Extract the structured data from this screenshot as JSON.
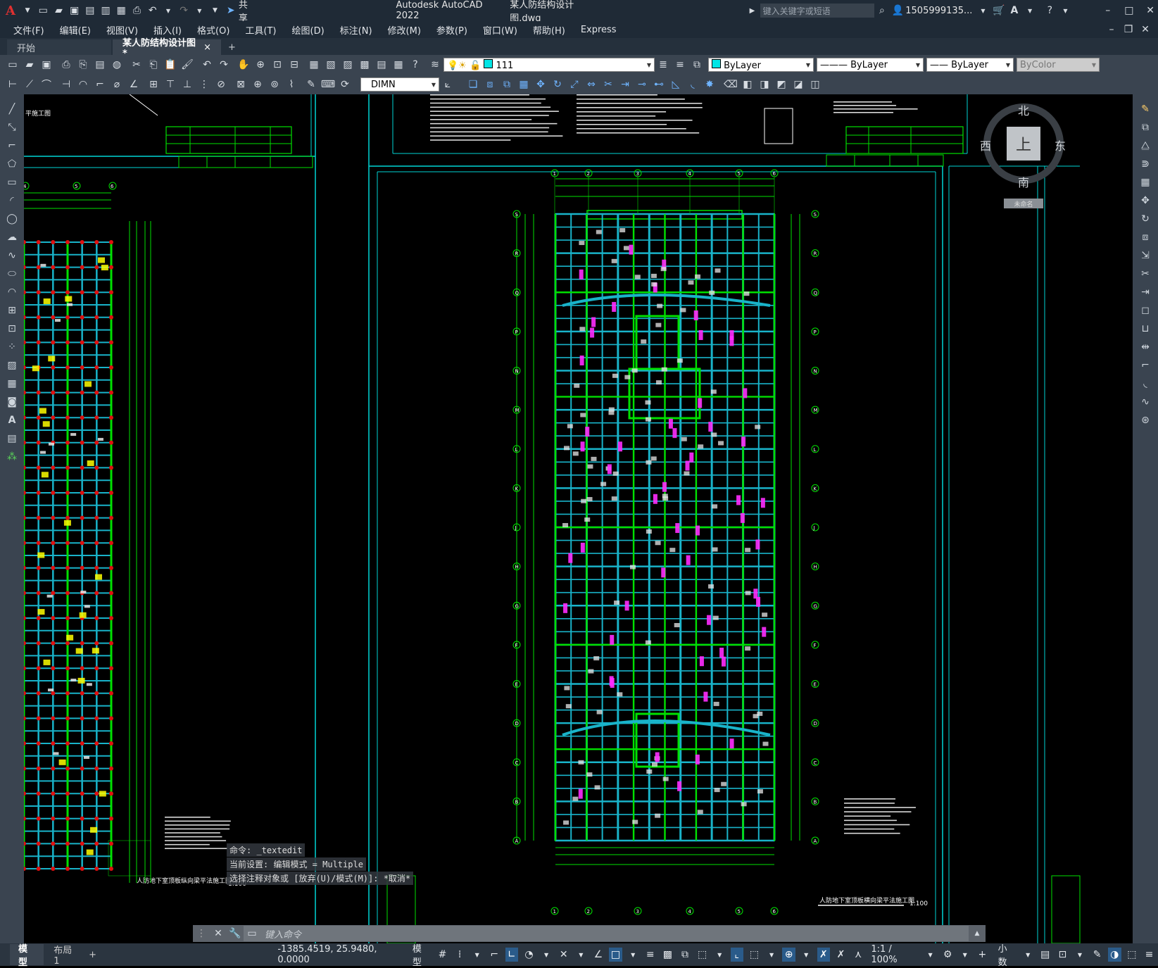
{
  "title": {
    "app": "Autodesk AutoCAD 2022",
    "file": "某人防结构设计图.dwg",
    "share": "共享",
    "search_placeholder": "键入关键字或短语",
    "user": "1505999135...",
    "app_letter": "A"
  },
  "menu": [
    "文件(F)",
    "编辑(E)",
    "视图(V)",
    "插入(I)",
    "格式(O)",
    "工具(T)",
    "绘图(D)",
    "标注(N)",
    "修改(M)",
    "参数(P)",
    "窗口(W)",
    "帮助(H)",
    "Express"
  ],
  "tabs": {
    "start": "开始",
    "doc": "某人防结构设计图*",
    "close": "×",
    "add": "+"
  },
  "toolbar": {
    "layer": "111",
    "color": "ByLayer",
    "linetype": "ByLayer",
    "lineweight": "ByLayer",
    "plotstyle": "ByColor",
    "dimstyle": "DIMN"
  },
  "viewcube": {
    "north": "北",
    "south": "南",
    "west": "西",
    "east": "东",
    "top": "上",
    "wcs": "未命名"
  },
  "command": {
    "line1": "命令: _textedit",
    "line2": "当前设置: 编辑模式 = Multiple",
    "line3": "选择注释对象或 [放弃(U)/模式(M)]: *取消*",
    "placeholder": "键入命令"
  },
  "drawing": {
    "title_left": "人防地下室顶板纵向梁平法施工图",
    "title_main": "人防地下室顶板横向梁平法施工图",
    "scale_left": "1:100",
    "scale_main": "1:100",
    "heading_left": "平施工图",
    "grid_numbers": [
      "1",
      "2",
      "3",
      "4",
      "5",
      "6"
    ],
    "grid_letters": [
      "S",
      "R",
      "Q",
      "P",
      "N",
      "M",
      "L",
      "K",
      "J",
      "H",
      "G",
      "F",
      "E",
      "D",
      "C",
      "B",
      "A"
    ]
  },
  "status": {
    "model_tab": "模型",
    "layout_tab": "布局1",
    "add_tab": "+",
    "coords": "-1385.4519, 25.9480, 0.0000",
    "model": "模型",
    "scale": "1:1 / 100%",
    "units": "小数"
  }
}
